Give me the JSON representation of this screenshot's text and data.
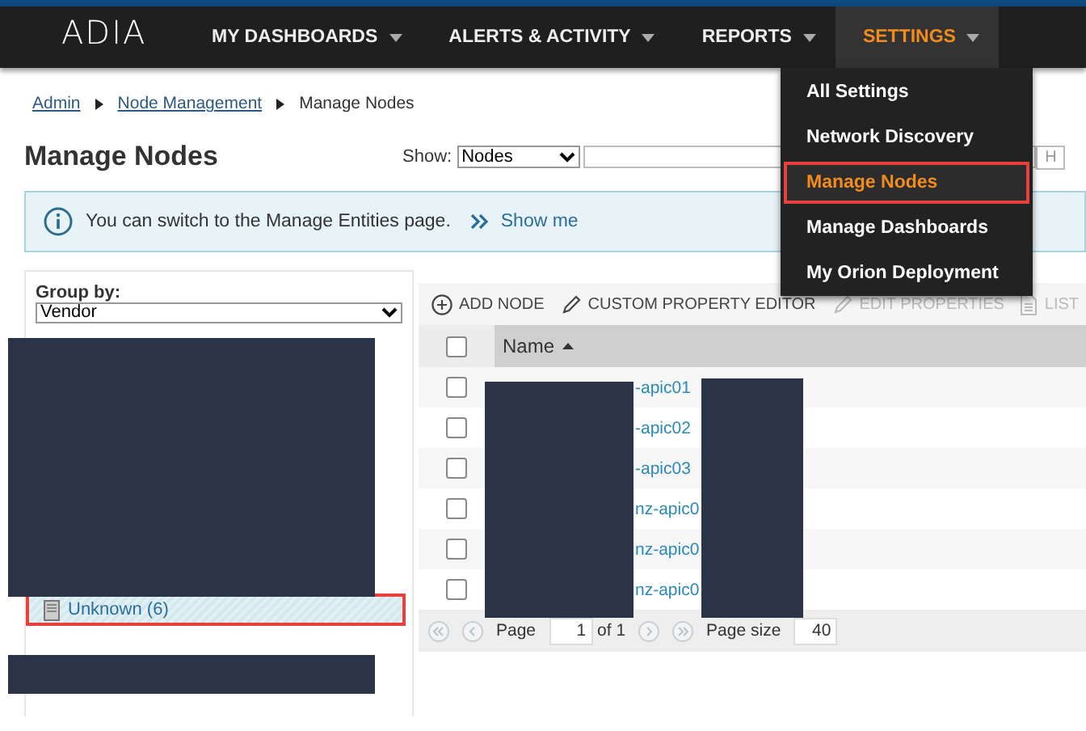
{
  "logo": "ADIA",
  "nav": [
    {
      "label": "MY DASHBOARDS",
      "selected": false
    },
    {
      "label": "ALERTS & ACTIVITY",
      "selected": false
    },
    {
      "label": "REPORTS",
      "selected": false
    },
    {
      "label": "SETTINGS",
      "selected": true
    }
  ],
  "settings_menu": [
    {
      "label": "All Settings",
      "selected": false,
      "outlined": false
    },
    {
      "label": "Network Discovery",
      "selected": false,
      "outlined": false
    },
    {
      "label": "Manage Nodes",
      "selected": true,
      "outlined": true
    },
    {
      "label": "Manage Dashboards",
      "selected": false,
      "outlined": false
    },
    {
      "label": "My Orion Deployment",
      "selected": false,
      "outlined": false
    }
  ],
  "breadcrumb": [
    {
      "label": "Admin",
      "link": true
    },
    {
      "label": "Node Management",
      "link": true
    },
    {
      "label": "Manage Nodes",
      "link": false
    }
  ],
  "title": "Manage Nodes",
  "show": {
    "label": "Show:",
    "value": "Nodes",
    "search_button": "H"
  },
  "info": {
    "text": "You can switch to the Manage Entities page.",
    "link": "Show me"
  },
  "group_by": {
    "label": "Group by:",
    "value": "Vendor",
    "items": [
      {
        "label": "Unknown (6)",
        "selected": true,
        "outlined": true
      }
    ]
  },
  "toolbar": [
    {
      "label": "ADD NODE",
      "kind": "add",
      "disabled": false
    },
    {
      "label": "CUSTOM PROPERTY EDITOR",
      "kind": "edit",
      "disabled": false
    },
    {
      "label": "EDIT PROPERTIES",
      "kind": "edit",
      "disabled": true
    },
    {
      "label": "LIST",
      "kind": "list",
      "disabled": true
    }
  ],
  "table": {
    "columns": [
      {
        "label": "Name",
        "sorted_ascending": true
      }
    ],
    "rows": [
      {
        "name": "-apic01",
        "checked": false
      },
      {
        "name": "-apic02",
        "checked": false
      },
      {
        "name": "-apic03",
        "checked": false
      },
      {
        "name": "nz-apic0",
        "checked": false
      },
      {
        "name": "nz-apic0",
        "checked": false
      },
      {
        "name": "nz-apic0",
        "checked": false
      }
    ],
    "header_checked": false
  },
  "pager": {
    "page_label": "Page",
    "page": "1",
    "of": "of 1",
    "size_label": "Page size",
    "size": "40"
  }
}
